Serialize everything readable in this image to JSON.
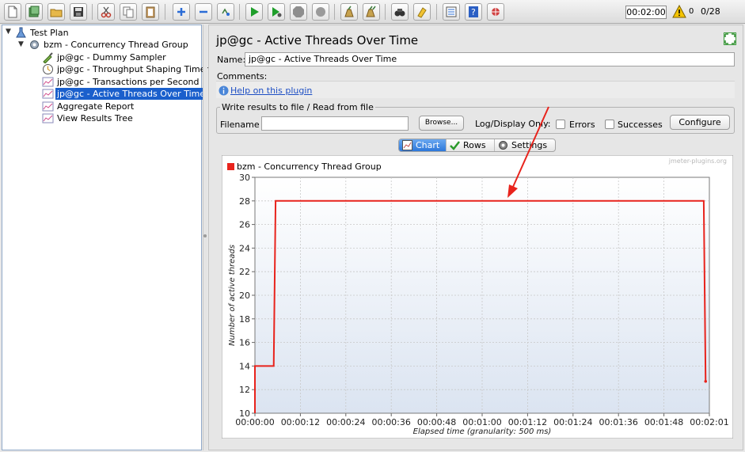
{
  "toolbar": {
    "buttons": [
      "new-icon",
      "templates-icon",
      "open-icon",
      "save-icon",
      "cut-icon",
      "copy-icon",
      "paste-icon",
      "expand-icon",
      "collapse-icon",
      "toggle-icon",
      "start-icon",
      "start-no-pauses-icon",
      "stop-icon",
      "shutdown-icon",
      "clear-icon",
      "clear-all-icon",
      "search-icon",
      "reset-search-icon",
      "function-helper-icon",
      "help-icon",
      "remote-icon"
    ],
    "timer": "00:02:00",
    "error_count": "0",
    "thread_count": "0/28"
  },
  "tree": {
    "items": [
      {
        "label": "Test Plan",
        "icon": "test-plan-icon"
      },
      {
        "label": "bzm - Concurrency Thread Group",
        "icon": "gear-icon"
      },
      {
        "label": "jp@gc - Dummy Sampler",
        "icon": "pipette-icon"
      },
      {
        "label": "jp@gc - Throughput Shaping Timer",
        "icon": "timer-icon"
      },
      {
        "label": "jp@gc - Transactions per Second",
        "icon": "graph-icon"
      },
      {
        "label": "jp@gc - Active Threads Over Time",
        "icon": "graph-icon"
      },
      {
        "label": "Aggregate Report",
        "icon": "graph-icon"
      },
      {
        "label": "View Results Tree",
        "icon": "graph-icon"
      }
    ]
  },
  "panel": {
    "title": "jp@gc - Active Threads Over Time",
    "name_label": "Name:",
    "name_value": "jp@gc - Active Threads Over Time",
    "comments_label": "Comments:",
    "help_link": "Help on this plugin",
    "file_legend": "Write results to file / Read from file",
    "filename_label": "Filename",
    "browse_label": "Browse...",
    "log_label": "Log/Display Only:",
    "errors_label": "Errors",
    "success_label": "Successes",
    "configure_label": "Configure",
    "tabs": [
      "Chart",
      "Rows",
      "Settings"
    ]
  },
  "colors": {
    "series": "#e8231c",
    "selection": "#1a5fcc",
    "arrow": "#e8231c"
  },
  "chart_data": {
    "type": "line",
    "watermark": "jmeter-plugins.org",
    "xlabel": "Elapsed time (granularity: 500 ms)",
    "ylabel": "Number of active threads",
    "ylim": [
      10,
      30
    ],
    "y_ticks": [
      10,
      12,
      14,
      16,
      18,
      20,
      22,
      24,
      26,
      28,
      30
    ],
    "x_ticks": [
      "00:00:00",
      "00:00:12",
      "00:00:24",
      "00:00:36",
      "00:00:48",
      "00:01:00",
      "00:01:12",
      "00:01:24",
      "00:01:36",
      "00:01:48",
      "00:02:01"
    ],
    "xlim_seconds": [
      0,
      121
    ],
    "legend_position": "top-left",
    "grid": true,
    "series": [
      {
        "name": "bzm - Concurrency Thread Group",
        "points": [
          [
            0,
            10
          ],
          [
            0,
            14
          ],
          [
            5,
            14
          ],
          [
            5.5,
            28
          ],
          [
            119.5,
            28
          ],
          [
            120,
            12.7
          ]
        ]
      }
    ],
    "annotation": "arrow"
  }
}
